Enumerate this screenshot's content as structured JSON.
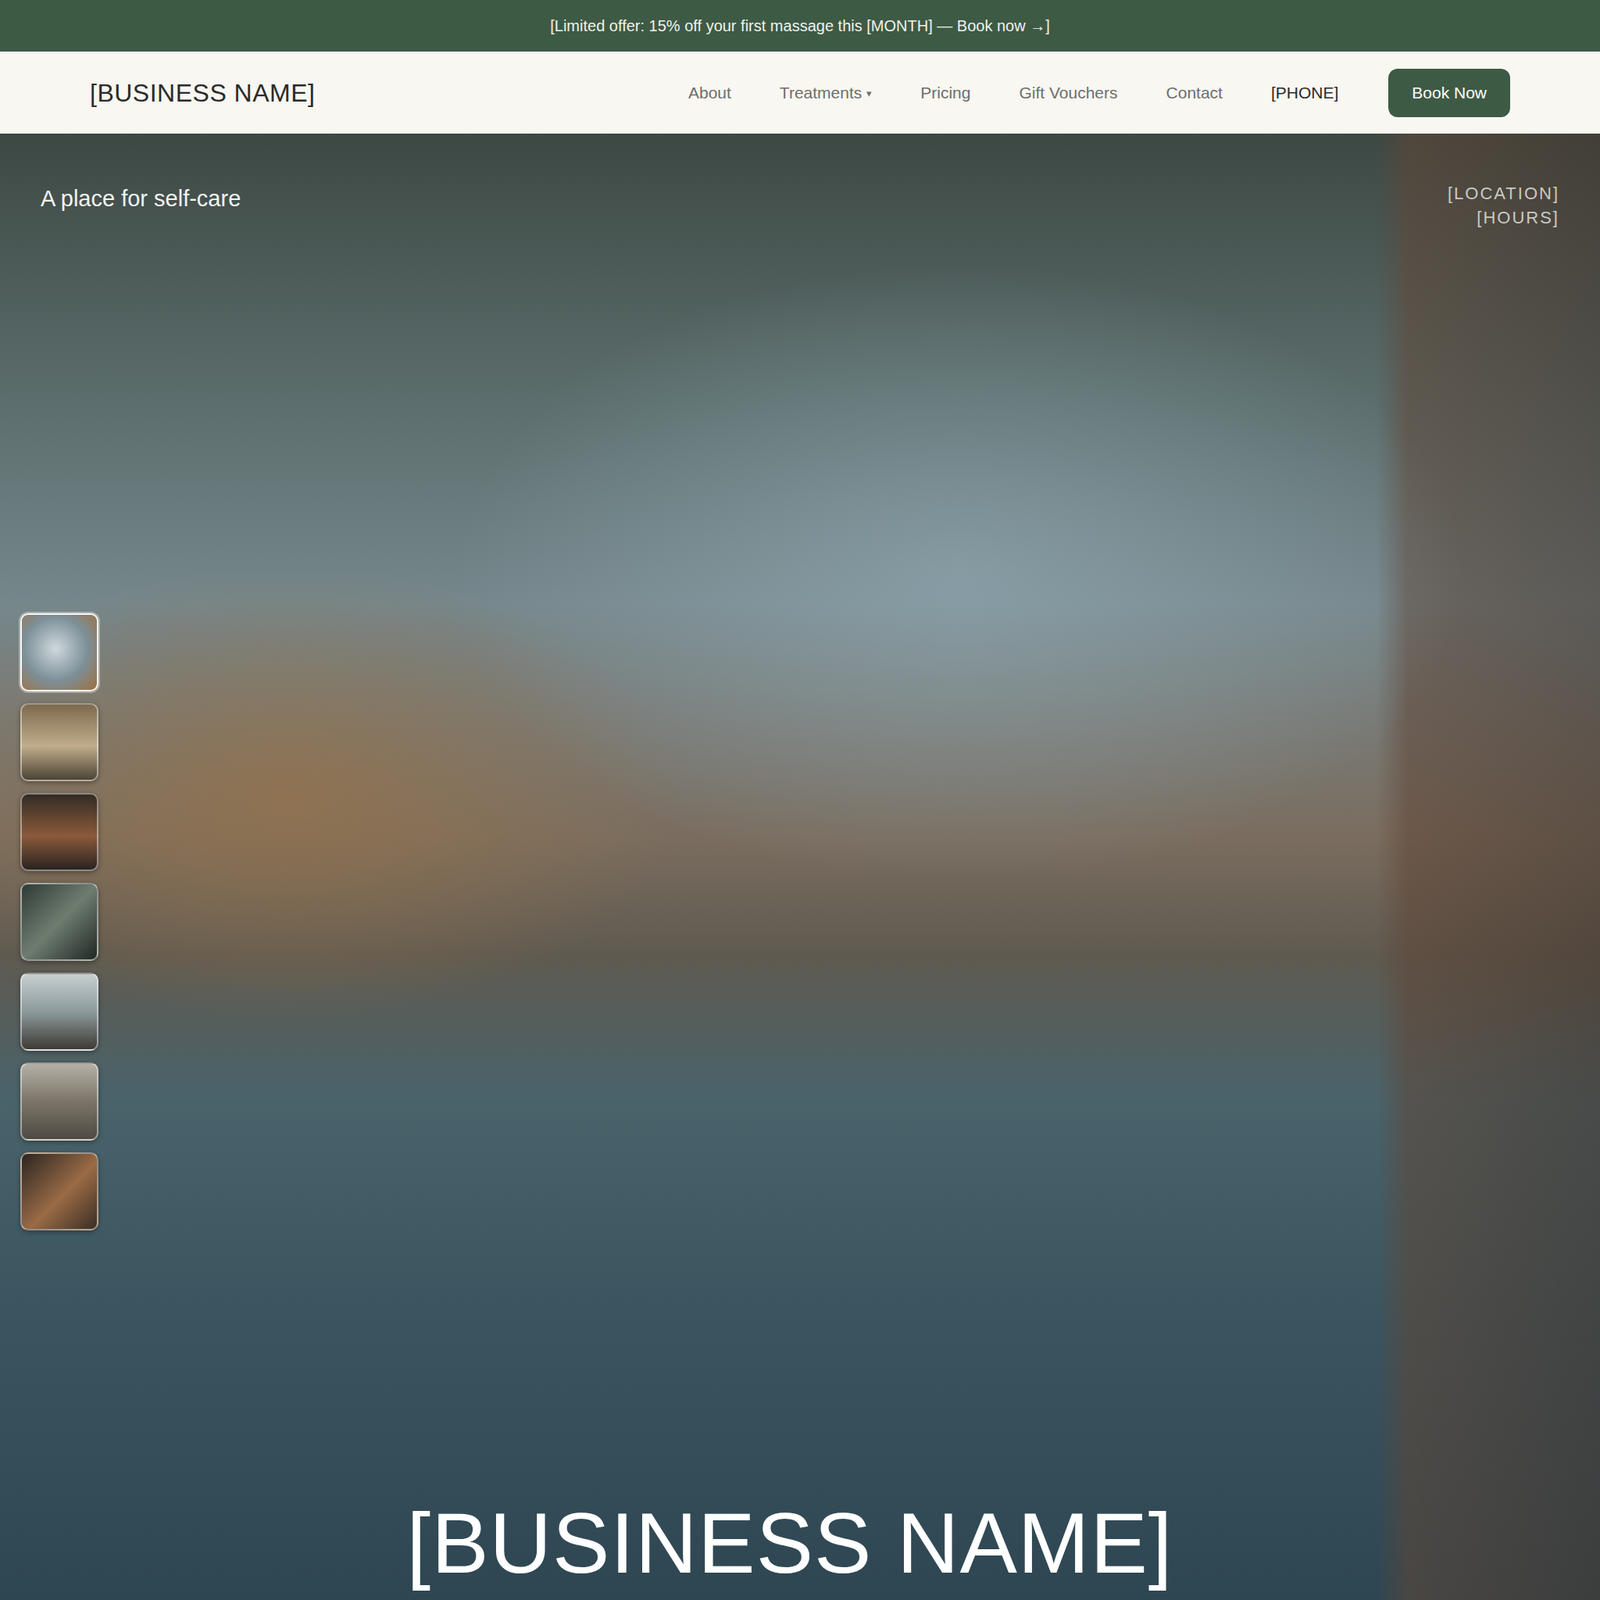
{
  "promo_bar": {
    "text": "[Limited offer: 15% off your first massage this [MONTH] — Book now →]"
  },
  "navbar": {
    "brand": "[BUSINESS NAME]",
    "items": [
      {
        "label": "About",
        "kind": "link"
      },
      {
        "label": "Treatments",
        "kind": "dropdown",
        "caret": "▾"
      },
      {
        "label": "Pricing",
        "kind": "link"
      },
      {
        "label": "Gift Vouchers",
        "kind": "link"
      },
      {
        "label": "Contact",
        "kind": "link"
      },
      {
        "label": "[PHONE]",
        "kind": "phone"
      }
    ],
    "cta": "Book Now"
  },
  "hero": {
    "tagline": "A place for self-care",
    "location": "[LOCATION]",
    "hours": "[HOURS]",
    "title": "[BUSINESS NAME]",
    "thumbnails": [
      {
        "selected": true
      },
      {
        "selected": false
      },
      {
        "selected": false
      },
      {
        "selected": false
      },
      {
        "selected": false
      },
      {
        "selected": false
      },
      {
        "selected": false
      }
    ]
  }
}
